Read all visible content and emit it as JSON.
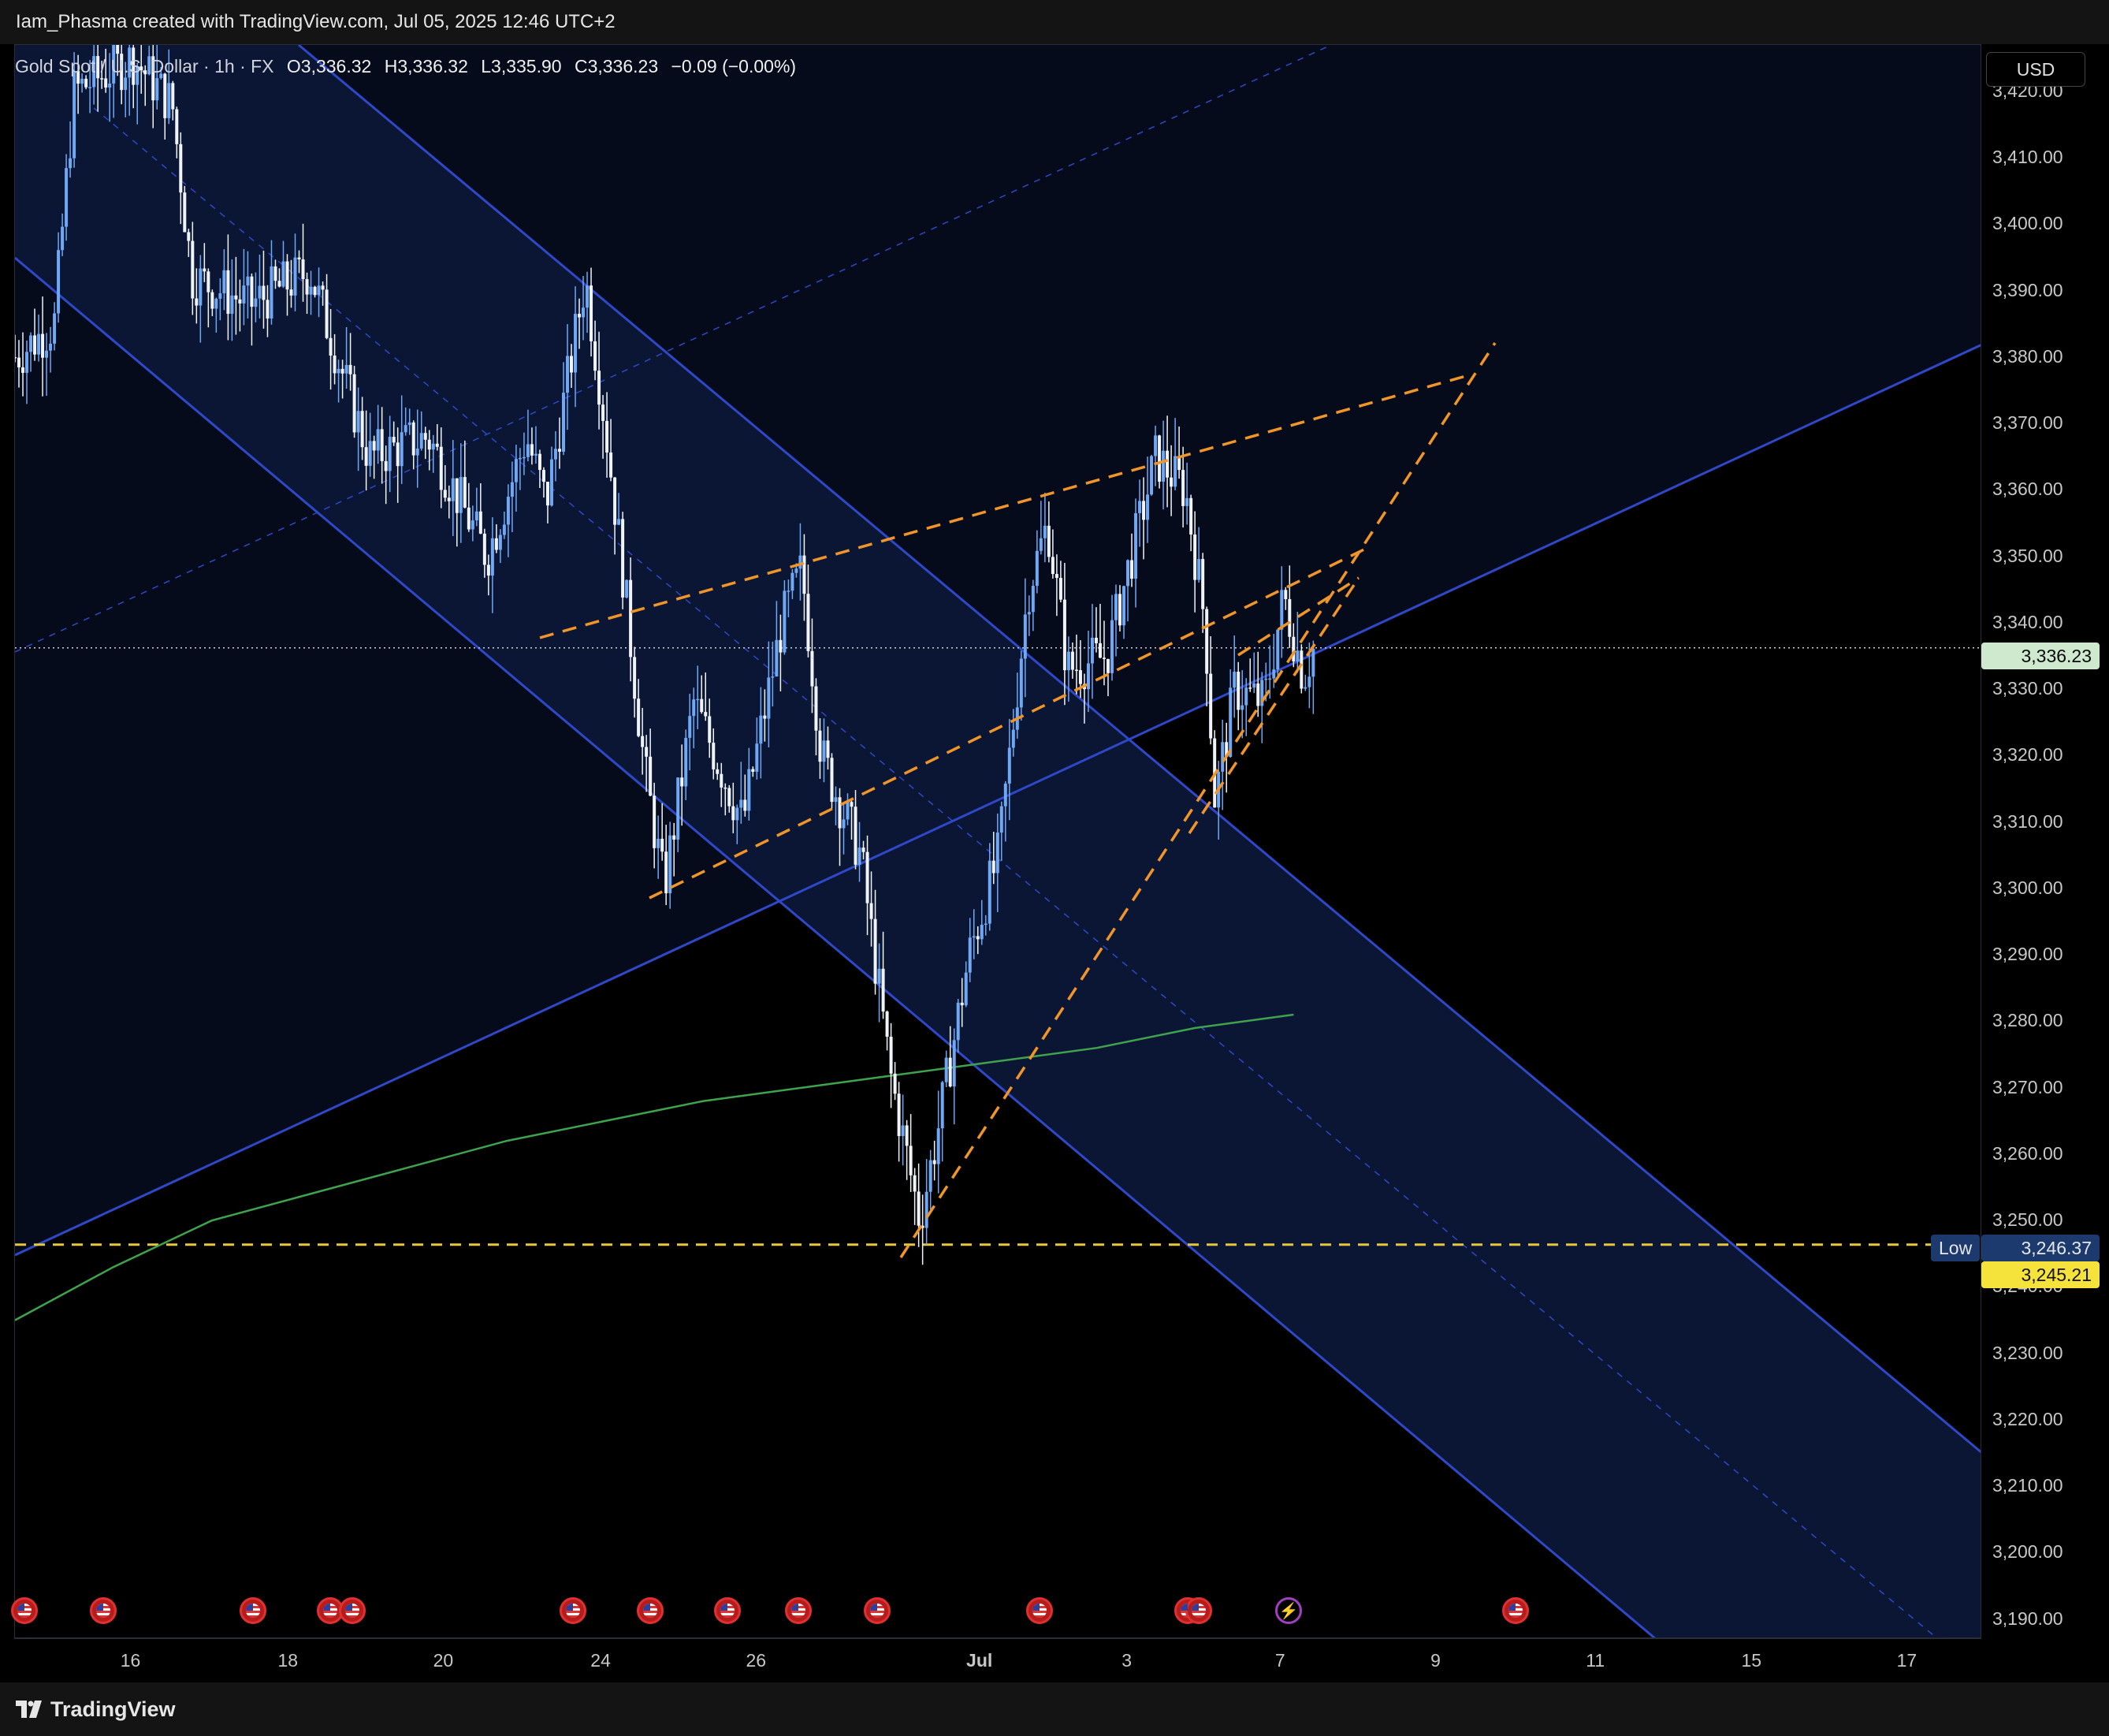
{
  "header": {
    "title": "Iam_Phasma created with TradingView.com, Jul 05, 2025 12:46 UTC+2"
  },
  "legend": {
    "symbol": "Gold Spot / U.S. Dollar · 1h · FX",
    "open": "O3,336.32",
    "high": "H3,336.32",
    "low": "L3,335.90",
    "close": "C3,336.23",
    "change": "−0.09 (−0.00%)"
  },
  "currency": "USD",
  "price_axis": {
    "ticks": [
      "3,420.00",
      "3,410.00",
      "3,400.00",
      "3,390.00",
      "3,380.00",
      "3,370.00",
      "3,360.00",
      "3,350.00",
      "3,340.00",
      "3,330.00",
      "3,320.00",
      "3,310.00",
      "3,300.00",
      "3,290.00",
      "3,280.00",
      "3,270.00",
      "3,260.00",
      "3,250.00",
      "3,240.00",
      "3,230.00",
      "3,220.00",
      "3,210.00",
      "3,200.00",
      "3,190.00"
    ],
    "tick_values": [
      3420,
      3410,
      3400,
      3390,
      3380,
      3370,
      3360,
      3350,
      3340,
      3330,
      3320,
      3310,
      3300,
      3290,
      3280,
      3270,
      3260,
      3250,
      3240,
      3230,
      3220,
      3210,
      3200,
      3190
    ]
  },
  "time_axis": {
    "labels": [
      "16",
      "18",
      "20",
      "24",
      "26",
      "Jul",
      "3",
      "7",
      "9",
      "11",
      "15",
      "17"
    ],
    "bold": [
      "Jul"
    ]
  },
  "badges": {
    "last_price": "3,336.23",
    "low_label": "Low",
    "low_value": "3,246.37",
    "level_value": "3,245.21"
  },
  "footer": {
    "brand": "TradingView"
  },
  "colors": {
    "background": "#000000",
    "channel_line": "#2e48c8",
    "channel_fill": "#0c1838",
    "orange_dashed": "#f0952a",
    "yellow_dashed": "#e8c83a",
    "moving_average": "#3fa34d",
    "candle_up": "#6fa8f5",
    "candle_down": "#f0f4f8"
  },
  "chart_data": {
    "type": "candlestick",
    "symbol": "XAUUSD",
    "interval": "1h",
    "ylim": [
      3187,
      3427
    ],
    "last_price": 3336.23,
    "low_level": 3246.37,
    "horizontal_level": 3245.21,
    "price_path_anchors": [
      {
        "x": 0,
        "y": 3380
      },
      {
        "x": 0.02,
        "y": 3385
      },
      {
        "x": 0.03,
        "y": 3420
      },
      {
        "x": 0.06,
        "y": 3425
      },
      {
        "x": 0.08,
        "y": 3418
      },
      {
        "x": 0.09,
        "y": 3392
      },
      {
        "x": 0.12,
        "y": 3388
      },
      {
        "x": 0.15,
        "y": 3393
      },
      {
        "x": 0.18,
        "y": 3365
      },
      {
        "x": 0.21,
        "y": 3368
      },
      {
        "x": 0.24,
        "y": 3350
      },
      {
        "x": 0.26,
        "y": 3368
      },
      {
        "x": 0.27,
        "y": 3358
      },
      {
        "x": 0.29,
        "y": 3392
      },
      {
        "x": 0.3,
        "y": 3370
      },
      {
        "x": 0.31,
        "y": 3345
      },
      {
        "x": 0.32,
        "y": 3318
      },
      {
        "x": 0.33,
        "y": 3300
      },
      {
        "x": 0.345,
        "y": 3328
      },
      {
        "x": 0.37,
        "y": 3310
      },
      {
        "x": 0.39,
        "y": 3340
      },
      {
        "x": 0.4,
        "y": 3348
      },
      {
        "x": 0.41,
        "y": 3320
      },
      {
        "x": 0.43,
        "y": 3305
      },
      {
        "x": 0.445,
        "y": 3272
      },
      {
        "x": 0.46,
        "y": 3250
      },
      {
        "x": 0.47,
        "y": 3265
      },
      {
        "x": 0.485,
        "y": 3290
      },
      {
        "x": 0.5,
        "y": 3305
      },
      {
        "x": 0.515,
        "y": 3345
      },
      {
        "x": 0.525,
        "y": 3355
      },
      {
        "x": 0.535,
        "y": 3333
      },
      {
        "x": 0.555,
        "y": 3335
      },
      {
        "x": 0.58,
        "y": 3365
      },
      {
        "x": 0.595,
        "y": 3360
      },
      {
        "x": 0.605,
        "y": 3340
      },
      {
        "x": 0.61,
        "y": 3313
      },
      {
        "x": 0.62,
        "y": 3330
      },
      {
        "x": 0.635,
        "y": 3328
      },
      {
        "x": 0.645,
        "y": 3344
      },
      {
        "x": 0.655,
        "y": 3332
      },
      {
        "x": 0.66,
        "y": 3336
      }
    ],
    "moving_average": [
      {
        "x": 0,
        "y": 3235
      },
      {
        "x": 0.05,
        "y": 3243
      },
      {
        "x": 0.1,
        "y": 3250
      },
      {
        "x": 0.15,
        "y": 3254
      },
      {
        "x": 0.2,
        "y": 3258
      },
      {
        "x": 0.25,
        "y": 3262
      },
      {
        "x": 0.3,
        "y": 3265
      },
      {
        "x": 0.35,
        "y": 3268
      },
      {
        "x": 0.4,
        "y": 3270
      },
      {
        "x": 0.45,
        "y": 3272
      },
      {
        "x": 0.5,
        "y": 3274
      },
      {
        "x": 0.55,
        "y": 3276
      },
      {
        "x": 0.6,
        "y": 3279
      },
      {
        "x": 0.65,
        "y": 3281
      }
    ]
  }
}
